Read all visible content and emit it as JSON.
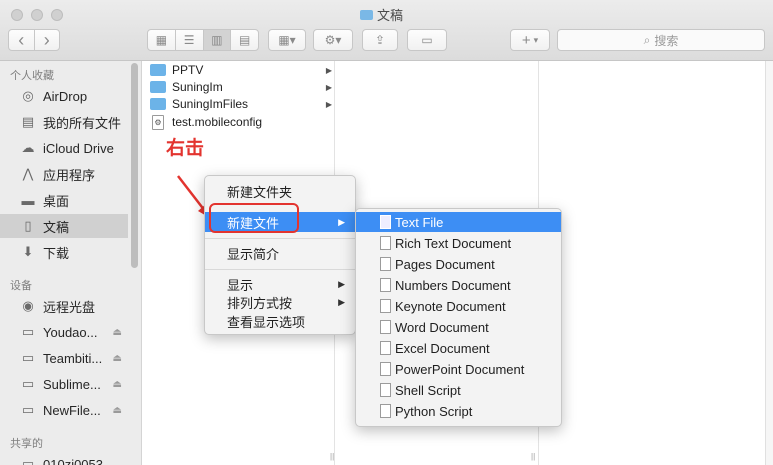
{
  "window": {
    "title": "文稿"
  },
  "toolbar": {
    "back": "‹",
    "forward": "›",
    "share": "⇪",
    "add": "+",
    "search_placeholder": "搜索"
  },
  "sidebar": {
    "sections": [
      {
        "heading": "个人收藏",
        "items": [
          {
            "label": "AirDrop",
            "icon": "airdrop-icon"
          },
          {
            "label": "我的所有文件",
            "icon": "all-files-icon"
          },
          {
            "label": "iCloud Drive",
            "icon": "cloud-icon"
          },
          {
            "label": "应用程序",
            "icon": "applications-icon"
          },
          {
            "label": "桌面",
            "icon": "desktop-icon"
          },
          {
            "label": "文稿",
            "icon": "documents-icon",
            "selected": true
          },
          {
            "label": "下载",
            "icon": "download-icon"
          }
        ]
      },
      {
        "heading": "设备",
        "items": [
          {
            "label": "远程光盘",
            "icon": "disc-icon"
          },
          {
            "label": "Youdao...",
            "icon": "disk-icon"
          },
          {
            "label": "Teambiti...",
            "icon": "disk-icon"
          },
          {
            "label": "Sublime...",
            "icon": "disk-icon"
          },
          {
            "label": "NewFile...",
            "icon": "disk-icon"
          }
        ]
      },
      {
        "heading": "共享的",
        "items": [
          {
            "label": "010zj0053",
            "icon": "computer-icon"
          }
        ]
      }
    ]
  },
  "files": [
    {
      "name": "PPTV",
      "type": "folder"
    },
    {
      "name": "SuningIm",
      "type": "folder"
    },
    {
      "name": "SuningImFiles",
      "type": "folder"
    },
    {
      "name": "test.mobileconfig",
      "type": "file"
    }
  ],
  "annotation": {
    "text": "右击"
  },
  "context_menu": {
    "items": [
      {
        "label": "新建文件夹"
      },
      {
        "label": "新建文件",
        "submenu": true,
        "highlighted": true
      },
      {
        "label": "显示简介"
      },
      {
        "label": "显示",
        "submenu": true
      },
      {
        "label": "排列方式按",
        "submenu": true
      },
      {
        "label": "查看显示选项"
      }
    ]
  },
  "submenu": {
    "items": [
      {
        "label": "Text File",
        "highlighted": true
      },
      {
        "label": "Rich Text Document"
      },
      {
        "label": "Pages Document"
      },
      {
        "label": "Numbers Document"
      },
      {
        "label": "Keynote Document"
      },
      {
        "label": "Word Document"
      },
      {
        "label": "Excel Document"
      },
      {
        "label": "PowerPoint Document"
      },
      {
        "label": "Shell Script"
      },
      {
        "label": "Python Script"
      }
    ]
  },
  "colors": {
    "highlight": "#3d8ef4",
    "annotation": "#e3342f",
    "folder": "#6cb3e8"
  }
}
